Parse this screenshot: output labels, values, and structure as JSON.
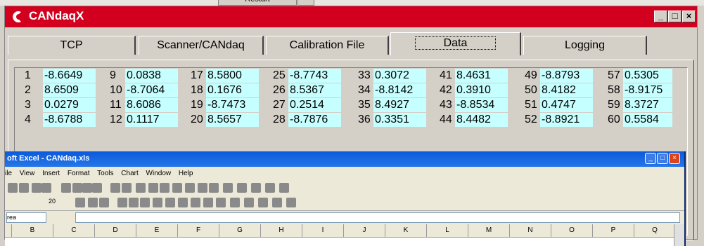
{
  "background": {
    "restart_label": "Restart"
  },
  "window": {
    "title": "CANdaqX",
    "titlebar_color": "#d2001e",
    "buttons": {
      "minimize": "_",
      "maximize": "□",
      "close": "×"
    }
  },
  "tabs": [
    {
      "label": "TCP",
      "active": false
    },
    {
      "label": "Scanner/CANdaq",
      "active": false
    },
    {
      "label": "Calibration File",
      "active": false
    },
    {
      "label": "Data",
      "active": true
    },
    {
      "label": "Logging",
      "active": false
    }
  ],
  "data_grid": {
    "value_bg": "#c6ffff",
    "columns": [
      [
        {
          "index": "1",
          "value": "-8.6649"
        },
        {
          "index": "2",
          "value": "8.6509"
        },
        {
          "index": "3",
          "value": "0.0279"
        },
        {
          "index": "4",
          "value": "-8.6788"
        }
      ],
      [
        {
          "index": "9",
          "value": "0.0838"
        },
        {
          "index": "10",
          "value": "-8.7064"
        },
        {
          "index": "11",
          "value": "8.6086"
        },
        {
          "index": "12",
          "value": "0.1117"
        }
      ],
      [
        {
          "index": "17",
          "value": "8.5800"
        },
        {
          "index": "18",
          "value": "0.1676"
        },
        {
          "index": "19",
          "value": "-8.7473"
        },
        {
          "index": "20",
          "value": "8.5657"
        }
      ],
      [
        {
          "index": "25",
          "value": "-8.7743"
        },
        {
          "index": "26",
          "value": "8.5367"
        },
        {
          "index": "27",
          "value": "0.2514"
        },
        {
          "index": "28",
          "value": "-8.7876"
        }
      ],
      [
        {
          "index": "33",
          "value": "0.3072"
        },
        {
          "index": "34",
          "value": "-8.8142"
        },
        {
          "index": "35",
          "value": "8.4927"
        },
        {
          "index": "36",
          "value": "0.3351"
        }
      ],
      [
        {
          "index": "41",
          "value": "8.4631"
        },
        {
          "index": "42",
          "value": "0.3910"
        },
        {
          "index": "43",
          "value": "-8.8534"
        },
        {
          "index": "44",
          "value": "8.4482"
        }
      ],
      [
        {
          "index": "49",
          "value": "-8.8793"
        },
        {
          "index": "50",
          "value": "8.4182"
        },
        {
          "index": "51",
          "value": "0.4747"
        },
        {
          "index": "52",
          "value": "-8.8921"
        }
      ],
      [
        {
          "index": "57",
          "value": "0.5305"
        },
        {
          "index": "58",
          "value": "-8.9175"
        },
        {
          "index": "59",
          "value": "8.3727"
        },
        {
          "index": "60",
          "value": "0.5584"
        }
      ]
    ]
  },
  "excel": {
    "title": "oft Excel - CANdaq.xls",
    "title_color": "#0a5adc",
    "menu": [
      "ile",
      "View",
      "Insert",
      "Format",
      "Tools",
      "Chart",
      "Window",
      "Help"
    ],
    "font_size": "20",
    "name_box": "rea",
    "columns": [
      "B",
      "C",
      "D",
      "E",
      "F",
      "G",
      "H",
      "I",
      "J",
      "K",
      "L",
      "M",
      "N",
      "O",
      "P",
      "Q"
    ]
  }
}
